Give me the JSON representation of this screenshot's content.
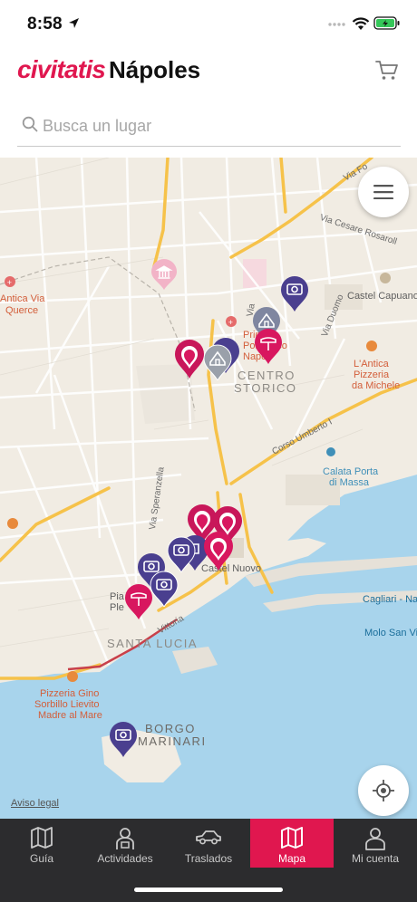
{
  "status_bar": {
    "time": "8:58"
  },
  "header": {
    "brand": "civitatis",
    "city": "Nápoles",
    "cart_icon": "cart-icon"
  },
  "search": {
    "placeholder": "Busca un lugar"
  },
  "map": {
    "labels": {
      "via_fo": "Via Fo",
      "via_cesare": "Via Cesare Rosaroll",
      "antica_via": "Antica Via",
      "querce": "Querce",
      "castel_capuano": "Castel Capuano",
      "primo": "Primo",
      "policlinico": "Policlinico",
      "napoli": "Napoli",
      "via": "Via",
      "via_duomo": "Via Duomo",
      "centro": "CENTRO",
      "storico": "STORICO",
      "lantica": "L'Antica",
      "pizzeria_michele_1": "Pizzeria",
      "pizzeria_michele_2": "da Michele",
      "corso_umberto": "Corso Umberto I",
      "calata_1": "Calata Porta",
      "calata_2": "di Massa",
      "via_speranzella": "Via Speranzella",
      "castel_nuovo": "Castel Nuovo",
      "piazza_1": "Pia",
      "piazza_2": "Ple",
      "vittoria": "Vittoria",
      "santa_lucia": "SANTA LUCIA",
      "cagliari": "Cagliari - Na",
      "molo": "Molo San Vi",
      "sorbillo_1": "Pizzeria Gino",
      "sorbillo_2": "Sorbillo Lievito",
      "sorbillo_3": "Madre al Mare",
      "borgo": "BORGO",
      "marinari": "MARINARI"
    },
    "legal": "Aviso legal",
    "menu_icon": "hamburger-menu-icon",
    "locate_icon": "locate-me-icon"
  },
  "tabs": [
    {
      "label": "Guía",
      "icon": "map-book-icon",
      "active": false
    },
    {
      "label": "Actividades",
      "icon": "guide-person-icon",
      "active": false
    },
    {
      "label": "Traslados",
      "icon": "car-icon",
      "active": false
    },
    {
      "label": "Mapa",
      "icon": "map-icon",
      "active": true
    },
    {
      "label": "Mi cuenta",
      "icon": "user-icon",
      "active": false
    }
  ],
  "colors": {
    "brand": "#e0174f",
    "pin_photo": "#4a3f8f",
    "pin_food": "#d8175f",
    "pin_sight": "#9aa0aa",
    "water": "#a8d4ec",
    "land": "#f1ece3",
    "tabbar": "#2c2c2e"
  }
}
